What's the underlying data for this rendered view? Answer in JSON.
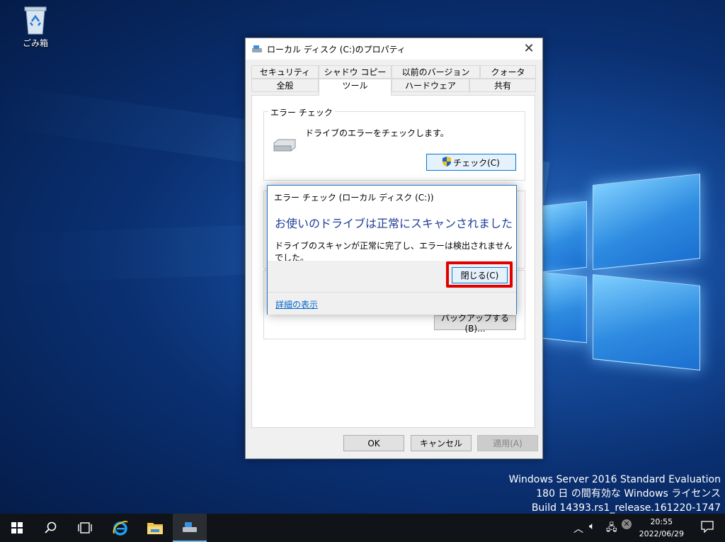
{
  "desktop": {
    "recycle_bin_label": "ごみ箱",
    "watermark": [
      "Windows Server 2016 Standard Evaluation",
      "180 日 の間有効な Windows ライセンス",
      "Build 14393.rs1_release.161220-1747"
    ]
  },
  "properties_window": {
    "title": "ローカル ディスク (C:)のプロパティ",
    "tabs_row1": [
      "セキュリティ",
      "シャドウ コピー",
      "以前のバージョン",
      "クォータ"
    ],
    "tabs_row2": [
      "全般",
      "ツール",
      "ハードウェア",
      "共有"
    ],
    "active_tab": "ツール",
    "error_check_group": {
      "legend": "エラー チェック",
      "description": "ドライブのエラーをチェックします。",
      "check_button": "チェック(C)"
    },
    "backup_button": "バックアップする(B)...",
    "ok_button": "OK",
    "cancel_button": "キャンセル",
    "apply_button": "適用(A)"
  },
  "error_dialog": {
    "title": "エラー チェック (ローカル ディスク (C:))",
    "heading": "お使いのドライブは正常にスキャンされました",
    "message": "ドライブのスキャンが正常に完了し、エラーは検出されませんでした。",
    "close_button": "閉じる(C)",
    "details_link": "詳細の表示"
  },
  "taskbar": {
    "clock_time": "20:55",
    "clock_date": "2022/06/29"
  },
  "colors": {
    "accent": "#0078d7",
    "highlight": "#e00000",
    "dialog_heading": "#1e3f9a"
  }
}
